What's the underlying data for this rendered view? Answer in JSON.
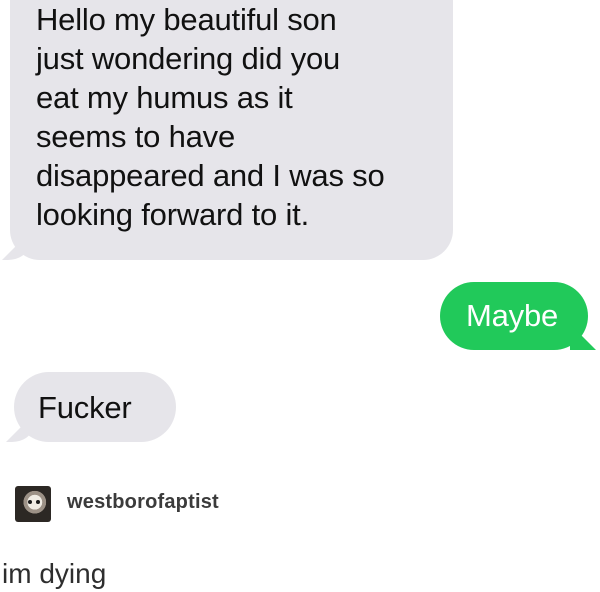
{
  "conversation": {
    "messages": [
      {
        "direction": "incoming",
        "text": "Hello my beautiful son\njust wondering did you\neat my humus as it\nseems to have\ndisappeared and I was so\nlooking forward to it."
      },
      {
        "direction": "outgoing",
        "text": "Maybe"
      },
      {
        "direction": "incoming",
        "text": "Fucker"
      }
    ],
    "colors": {
      "incoming_bubble": "#e6e5ea",
      "outgoing_bubble": "#21c95a"
    }
  },
  "post": {
    "avatar_icon": "cat-avatar-icon",
    "username": "westborofaptist",
    "comment": "im dying"
  }
}
